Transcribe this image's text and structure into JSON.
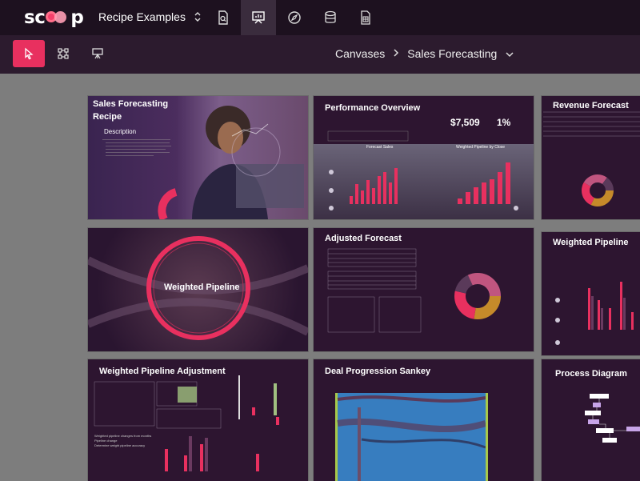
{
  "app": {
    "logo_text_left": "sc",
    "logo_text_right": "p",
    "project_name": "Recipe Examples"
  },
  "topbar_icons": [
    "search-doc-icon",
    "presentation-icon",
    "compass-icon",
    "database-icon",
    "table-icon"
  ],
  "toolbar": {
    "tools": [
      "select-tool",
      "connect-tool",
      "present-tool"
    ]
  },
  "breadcrumb": {
    "root": "Canvases",
    "current": "Sales Forecasting"
  },
  "slides": {
    "s1": {
      "title": "Sales Forecasting",
      "title2": "Recipe",
      "sub": "Description"
    },
    "s2": {
      "title": "Performance Overview",
      "kpi1": "$7,509",
      "kpi2": "1%",
      "chart1": "Forecast Sales",
      "chart2": "Weighted Pipeline by Close"
    },
    "s3": {
      "title": "Revenue Forecast"
    },
    "s4": {
      "title": "Weighted Pipeline"
    },
    "s5": {
      "title": "Adjusted Forecast"
    },
    "s6": {
      "title": "Weighted Pipeline"
    },
    "s7": {
      "title": "Weighted Pipeline Adjustment",
      "bullets": [
        "Weighted pipeline changes from months",
        "Pipeline change",
        "Determine weight pipeline accuracy"
      ]
    },
    "s8": {
      "title": "Deal Progression Sankey"
    },
    "s9": {
      "title": "Process Diagram"
    }
  },
  "colors": {
    "accent": "#e8305f",
    "topbar": "#1d111f",
    "subbar": "#2c1b2e",
    "canvas": "#7d7d7d",
    "slide_bg": "#2a1630",
    "bar": "#e8305f",
    "donut_gold": "#c58a2a",
    "donut_pink": "#c0557f",
    "sankey_blue": "#3a8fd8"
  }
}
